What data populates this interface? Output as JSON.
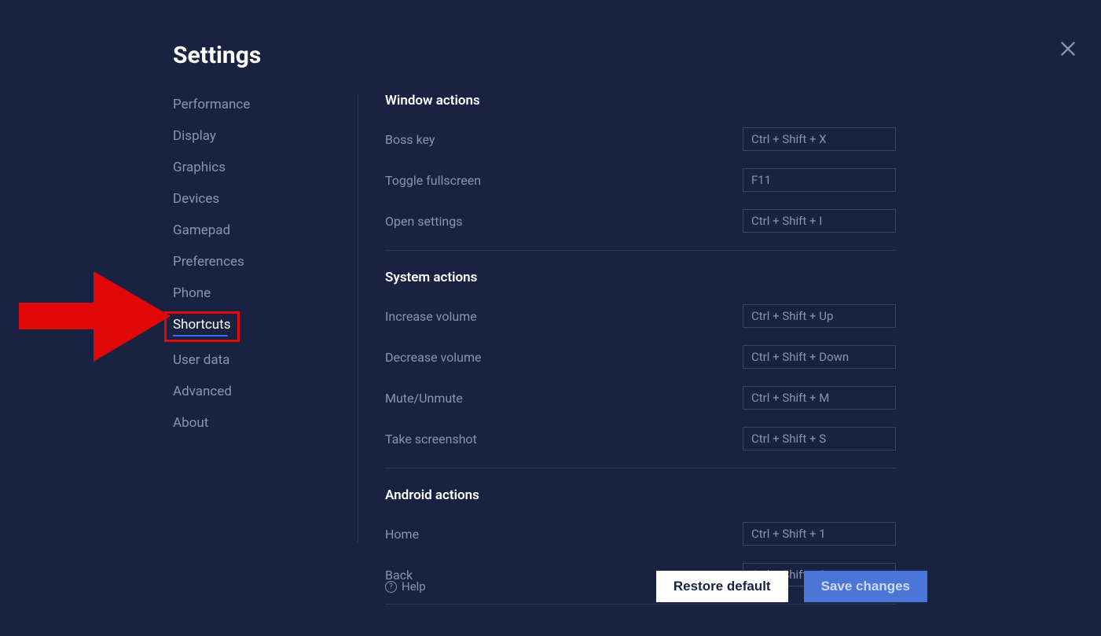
{
  "header": {
    "title": "Settings"
  },
  "sidebar": {
    "items": [
      {
        "label": "Performance"
      },
      {
        "label": "Display"
      },
      {
        "label": "Graphics"
      },
      {
        "label": "Devices"
      },
      {
        "label": "Gamepad"
      },
      {
        "label": "Preferences"
      },
      {
        "label": "Phone"
      },
      {
        "label": "Shortcuts"
      },
      {
        "label": "User data"
      },
      {
        "label": "Advanced"
      },
      {
        "label": "About"
      }
    ]
  },
  "sections": {
    "window": {
      "title": "Window actions",
      "rows": [
        {
          "label": "Boss key",
          "value": "Ctrl + Shift + X"
        },
        {
          "label": "Toggle fullscreen",
          "value": "F11"
        },
        {
          "label": "Open settings",
          "value": "Ctrl + Shift + I"
        }
      ]
    },
    "system": {
      "title": "System actions",
      "rows": [
        {
          "label": "Increase volume",
          "value": "Ctrl + Shift + Up"
        },
        {
          "label": "Decrease volume",
          "value": "Ctrl + Shift + Down"
        },
        {
          "label": "Mute/Unmute",
          "value": "Ctrl + Shift + M"
        },
        {
          "label": "Take screenshot",
          "value": "Ctrl + Shift + S"
        }
      ]
    },
    "android": {
      "title": "Android actions",
      "rows": [
        {
          "label": "Home",
          "value": "Ctrl + Shift + 1"
        },
        {
          "label": "Back",
          "value": "Ctrl + Shift + 2"
        }
      ]
    }
  },
  "footer": {
    "help": "Help",
    "restore": "Restore default",
    "save": "Save changes"
  }
}
